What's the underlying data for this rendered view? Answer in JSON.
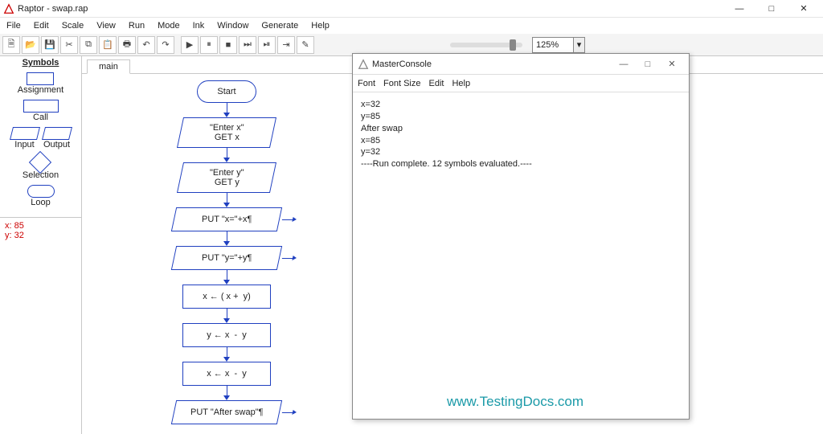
{
  "window": {
    "title": "Raptor - swap.rap"
  },
  "menu": [
    "File",
    "Edit",
    "Scale",
    "View",
    "Run",
    "Mode",
    "Ink",
    "Window",
    "Generate",
    "Help"
  ],
  "toolbar_icons": [
    "new",
    "open",
    "save",
    "cut",
    "copy",
    "paste",
    "print",
    "undo",
    "redo"
  ],
  "run_icons": [
    "play",
    "pause",
    "stop",
    "step",
    "step-end",
    "step-run"
  ],
  "pen_icon": "pen",
  "zoom": "125%",
  "sidebar": {
    "heading": "Symbols",
    "items": [
      "Assignment",
      "Call",
      "Input",
      "Output",
      "Selection",
      "Loop"
    ]
  },
  "watch": [
    "x: 85",
    "y: 32"
  ],
  "tabs": [
    "main"
  ],
  "flow": [
    {
      "type": "start",
      "text": "Start"
    },
    {
      "type": "input",
      "text": "\"Enter x\"\nGET x"
    },
    {
      "type": "input",
      "text": "\"Enter y\"\nGET y"
    },
    {
      "type": "output",
      "text": "PUT \"x=\"+x¶"
    },
    {
      "type": "output",
      "text": "PUT \"y=\"+y¶"
    },
    {
      "type": "assign",
      "text": "x ← ( x +  y)"
    },
    {
      "type": "assign",
      "text": "y ← x  -  y"
    },
    {
      "type": "assign",
      "text": "x ← x  -  y"
    },
    {
      "type": "output",
      "text": "PUT \"After swap\"¶"
    }
  ],
  "console": {
    "title": "MasterConsole",
    "menu": [
      "Font",
      "Font Size",
      "Edit",
      "Help"
    ],
    "lines": [
      "x=32",
      "y=85",
      "After swap",
      "x=85",
      "y=32",
      "----Run complete.  12 symbols evaluated.----"
    ]
  },
  "watermark": "www.TestingDocs.com",
  "window_controls": {
    "min": "—",
    "max": "□",
    "close": "✕"
  }
}
